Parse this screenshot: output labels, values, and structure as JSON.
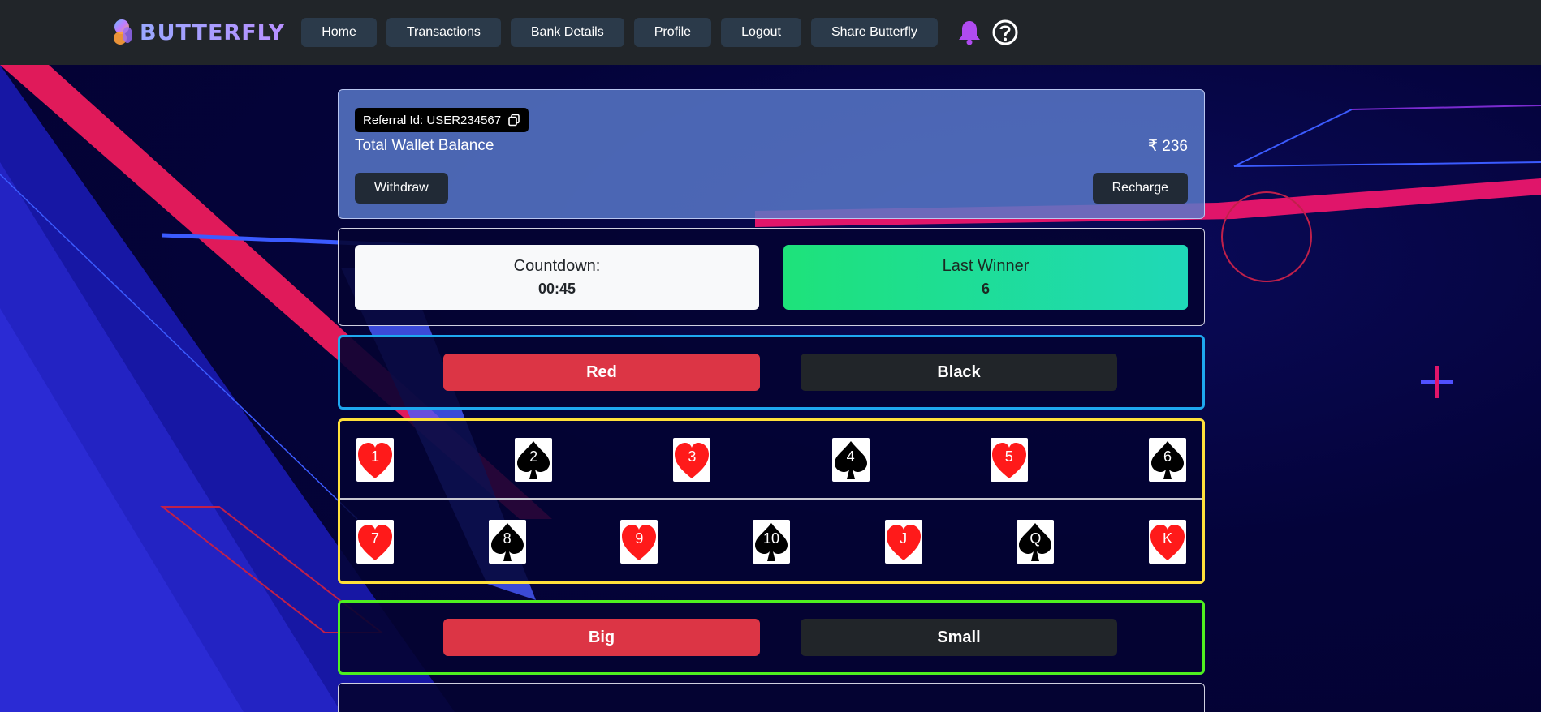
{
  "header": {
    "brand": "BUTTERFLY",
    "nav": [
      "Home",
      "Transactions",
      "Bank Details",
      "Profile",
      "Logout",
      "Share Butterfly"
    ],
    "icons": [
      "bell-icon",
      "help-icon"
    ]
  },
  "wallet": {
    "referral_label": "Referral Id: USER234567",
    "balance_label": "Total Wallet Balance",
    "balance_amount": "₹ 236",
    "withdraw_label": "Withdraw",
    "recharge_label": "Recharge"
  },
  "status": {
    "countdown_label": "Countdown:",
    "countdown_value": "00:45",
    "winner_label": "Last Winner",
    "winner_value": "6"
  },
  "color_bet": {
    "red_label": "Red",
    "black_label": "Black"
  },
  "cards": {
    "row1": [
      {
        "label": "1",
        "suit": "heart"
      },
      {
        "label": "2",
        "suit": "spade"
      },
      {
        "label": "3",
        "suit": "heart"
      },
      {
        "label": "4",
        "suit": "spade"
      },
      {
        "label": "5",
        "suit": "heart"
      },
      {
        "label": "6",
        "suit": "spade"
      }
    ],
    "row2": [
      {
        "label": "7",
        "suit": "heart"
      },
      {
        "label": "8",
        "suit": "spade"
      },
      {
        "label": "9",
        "suit": "heart"
      },
      {
        "label": "10",
        "suit": "spade"
      },
      {
        "label": "J",
        "suit": "heart"
      },
      {
        "label": "Q",
        "suit": "spade"
      },
      {
        "label": "K",
        "suit": "heart"
      }
    ]
  },
  "size_bet": {
    "big_label": "Big",
    "small_label": "Small"
  },
  "colors": {
    "red": "#dc3545",
    "dark": "#212529",
    "heart": "#ff1a1a",
    "spade": "#000000"
  }
}
